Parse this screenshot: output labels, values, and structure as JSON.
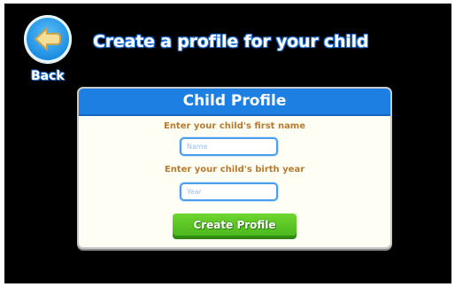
{
  "page": {
    "title": "Create a profile for your child"
  },
  "back": {
    "label": "Back",
    "icon": "arrow-left-icon"
  },
  "profile_form": {
    "title": "Child Profile",
    "first_name": {
      "label": "Enter your child's first name",
      "placeholder": "Name",
      "value": ""
    },
    "birth_year": {
      "label": "Enter your child's birth year",
      "placeholder": "Year",
      "value": ""
    },
    "submit_label": "Create Profile"
  },
  "colors": {
    "background": "#000000",
    "header_blue": "#1e7fe2",
    "label_orange": "#b87a2e",
    "button_green": "#5cc42a",
    "panel_cream": "#fffef5"
  }
}
